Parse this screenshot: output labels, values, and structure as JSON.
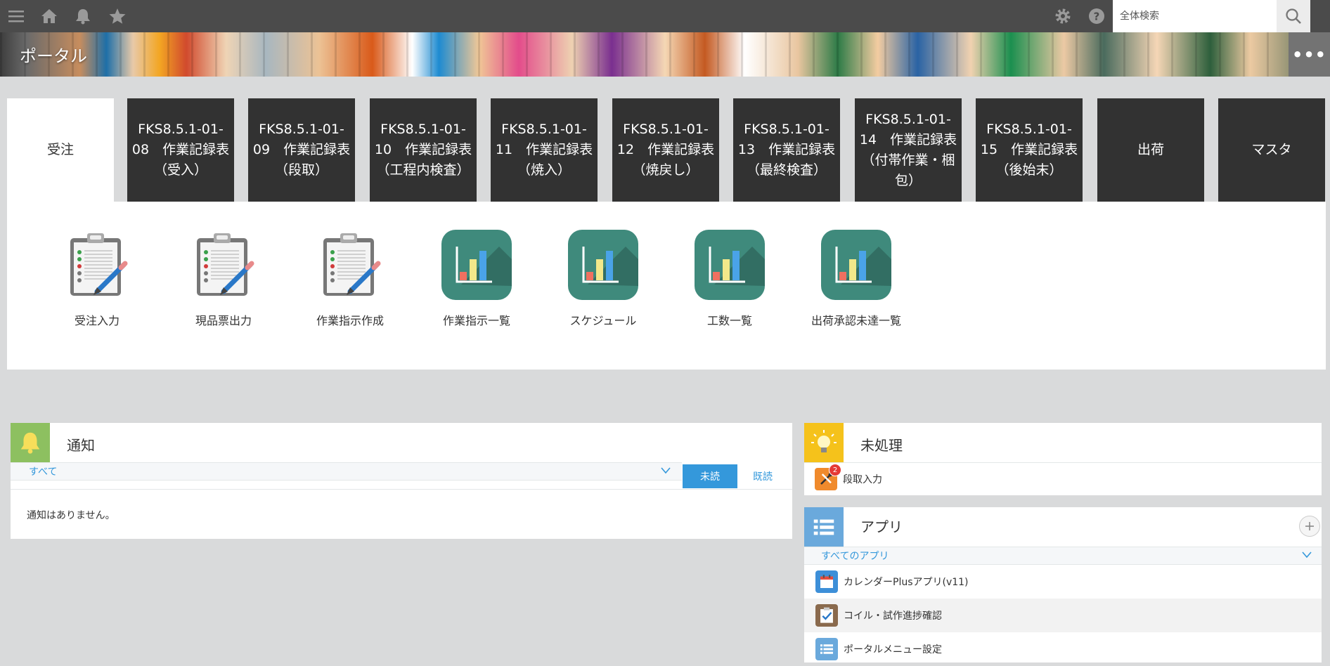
{
  "search": {
    "placeholder": "全体検索"
  },
  "banner": {
    "title": "ポータル",
    "more": "•••"
  },
  "tabs": [
    {
      "label": "受注",
      "active": true
    },
    {
      "label": "FKS8.5.1-01-08　作業記録表（受入）"
    },
    {
      "label": "FKS8.5.1-01-09　作業記録表（段取）"
    },
    {
      "label": "FKS8.5.1-01-10　作業記録表（工程内検査）"
    },
    {
      "label": "FKS8.5.1-01-11　作業記録表（焼入）"
    },
    {
      "label": "FKS8.5.1-01-12　作業記録表（焼戻し）"
    },
    {
      "label": "FKS8.5.1-01-13　作業記録表（最終検査）"
    },
    {
      "label": "FKS8.5.1-01-14　作業記録表（付帯作業・梱包）"
    },
    {
      "label": "FKS8.5.1-01-15　作業記録表（後始末）"
    },
    {
      "label": "出荷"
    },
    {
      "label": "マスタ"
    }
  ],
  "panel_apps": [
    {
      "label": "受注入力",
      "icon": "clipboard-icon"
    },
    {
      "label": "現品票出力",
      "icon": "clipboard-icon"
    },
    {
      "label": "作業指示作成",
      "icon": "clipboard-icon"
    },
    {
      "label": "作業指示一覧",
      "icon": "bar-chart-icon"
    },
    {
      "label": "スケジュール",
      "icon": "bar-chart-icon"
    },
    {
      "label": "工数一覧",
      "icon": "bar-chart-icon"
    },
    {
      "label": "出荷承認未達一覧",
      "icon": "bar-chart-icon"
    }
  ],
  "notifications": {
    "title": "通知",
    "filter": "すべて",
    "unread": "未読",
    "read": "既読",
    "empty": "通知はありません。"
  },
  "pending": {
    "title": "未処理",
    "items": [
      {
        "label": "段取入力",
        "badge": "2"
      }
    ]
  },
  "apps": {
    "title": "アプリ",
    "filter": "すべてのアプリ",
    "items": [
      {
        "label": "カレンダーPlusアプリ(v11)",
        "icon": "calendar-icon"
      },
      {
        "label": "コイル・試作進捗確認",
        "icon": "checklist-icon"
      },
      {
        "label": "ポータルメニュー設定",
        "icon": "list-icon"
      }
    ]
  },
  "colors": {
    "accent": "#3498db",
    "tab_dark": "#323232",
    "topbar": "#4b4b4b",
    "teal_icon": "#3f8a7c"
  }
}
